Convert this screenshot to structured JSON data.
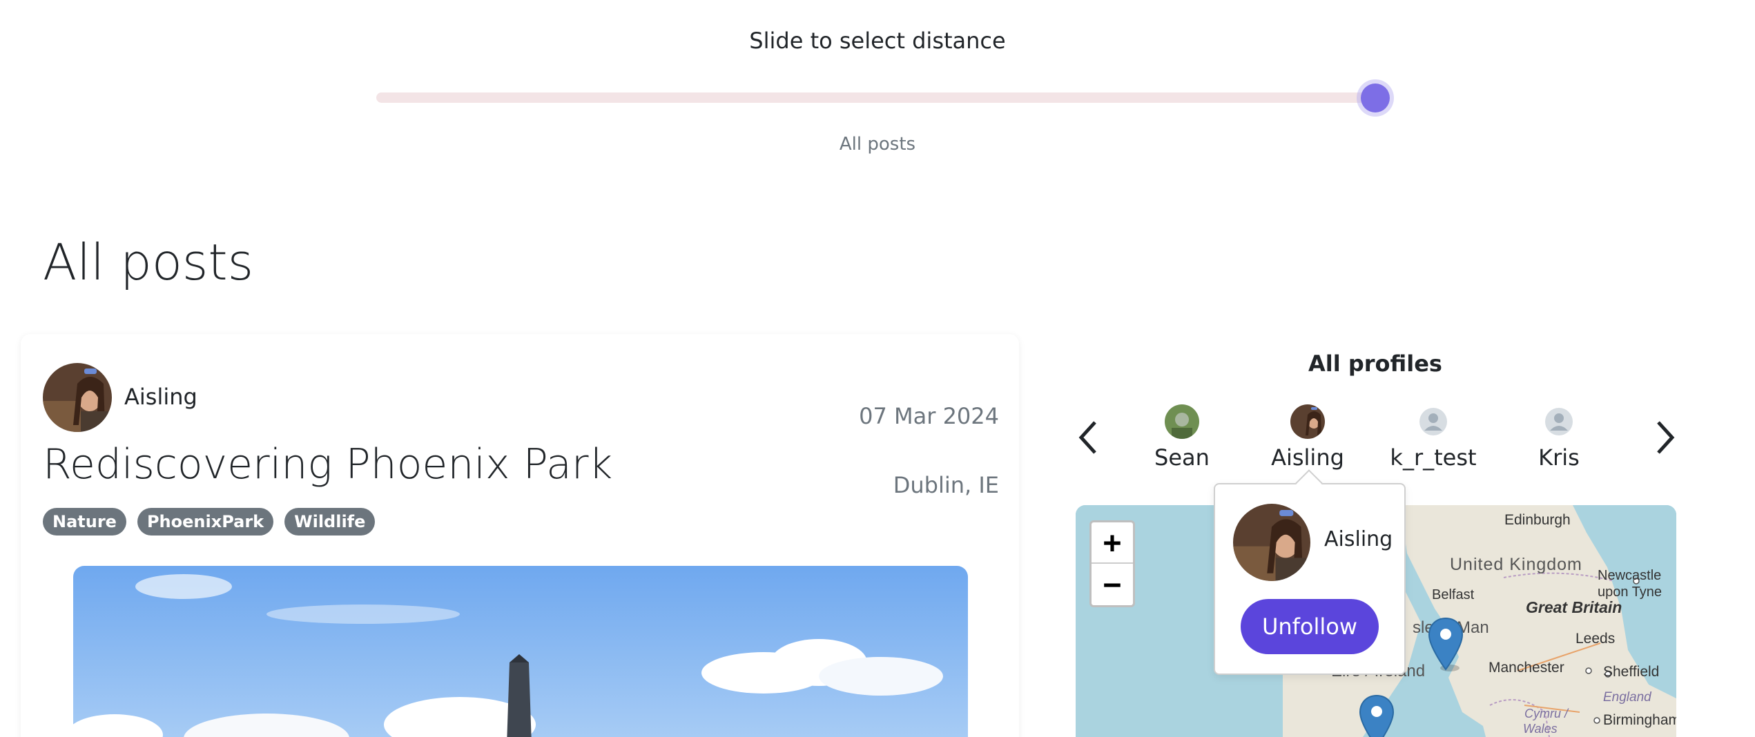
{
  "slider": {
    "title": "Slide to select distance",
    "value_label": "All posts",
    "value_fraction": 1.0
  },
  "page": {
    "heading": "All posts"
  },
  "post": {
    "author": "Aisling",
    "date": "07 Mar 2024",
    "title": "Rediscovering Phoenix Park",
    "location": "Dublin, IE",
    "tags": [
      "Nature",
      "PhoenixPark",
      "Wildlife"
    ]
  },
  "profiles": {
    "title": "All profiles",
    "items": [
      {
        "name": "Sean",
        "avatar": "photo-avatar"
      },
      {
        "name": "Aisling",
        "avatar": "photo-avatar"
      },
      {
        "name": "k_r_test",
        "avatar": "default-avatar-icon"
      },
      {
        "name": "Kris",
        "avatar": "default-avatar-icon"
      }
    ]
  },
  "popover": {
    "name": "Aisling",
    "button_label": "Unfollow"
  },
  "map": {
    "zoom_in": "+",
    "zoom_out": "−",
    "labels": {
      "edinburgh": "Edinburgh",
      "uk": "United Kingdom",
      "newcastle_1": "Newcastle",
      "newcastle_2": "upon Tyne",
      "belfast": "Belfast",
      "isle_of_man": "sle of Man",
      "great_britain": "Great Britain",
      "leeds": "Leeds",
      "manchester": "Manchester",
      "sheffield": "Sheffield",
      "eire_ireland": "Éire / Ireland",
      "england": "England",
      "cymru": "Cymru /",
      "wales": "Wales",
      "birmingham": "Birmingham"
    }
  },
  "colors": {
    "accent": "#5b45dc",
    "slider_thumb": "#7d6ee6",
    "slider_track": "#f3e4e6",
    "tag_bg": "#6c757d",
    "muted_text": "#6c757d",
    "map_sea": "#aad3df",
    "map_land": "#e8e4d8",
    "marker": "#3b82c4"
  }
}
